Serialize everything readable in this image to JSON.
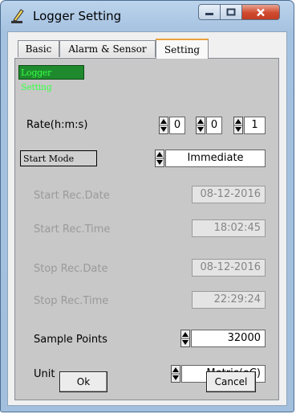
{
  "window": {
    "title": "Logger Setting"
  },
  "tabs": [
    {
      "label": "Basic"
    },
    {
      "label": "Alarm & Sensor"
    },
    {
      "label": "Setting"
    }
  ],
  "group": {
    "label": "Logger Setting"
  },
  "rate": {
    "label": "Rate(h:m:s)",
    "hours": "0",
    "minutes": "0",
    "seconds": "1"
  },
  "start_mode": {
    "label": "Start Mode",
    "value": "Immediate"
  },
  "start_rec_date": {
    "label": "Start Rec.Date",
    "value": "08-12-2016"
  },
  "start_rec_time": {
    "label": "Start Rec.Time",
    "value": "18:02:45"
  },
  "stop_rec_date": {
    "label": "Stop Rec.Date",
    "value": "08-12-2016"
  },
  "stop_rec_time": {
    "label": "Stop Rec.Time",
    "value": "22:29:24"
  },
  "sample_points": {
    "label": "Sample Points",
    "value": "32000"
  },
  "unit": {
    "label": "Unit",
    "value": "Metric(oC)"
  },
  "buttons": {
    "ok": "Ok",
    "cancel": "Cancel"
  },
  "colors": {
    "group_label_bg": "#1f8a2d",
    "group_label_text": "#39ff48",
    "active_tab_accent": "#e9a23b",
    "close_button": "#c8432a"
  },
  "icons": {
    "app": "pen-icon",
    "minimize": "minimize-icon",
    "maximize": "maximize-icon",
    "close": "close-icon",
    "spinner": "spinner-icon"
  }
}
